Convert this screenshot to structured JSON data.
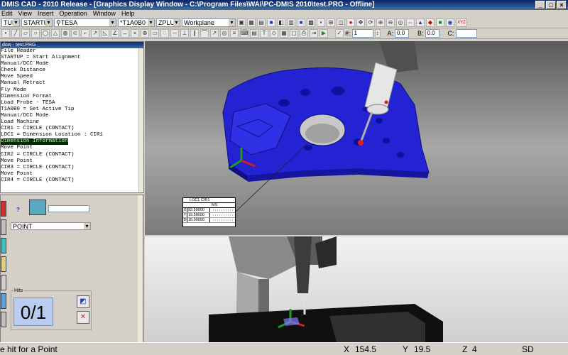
{
  "window": {
    "title": "DMIS CAD - 2010 Release - [Graphics Display Window - C:\\Program Files\\WAI\\PC-DMIS 2010\\test.PRG - Offline]"
  },
  "menu": [
    "Edit",
    "View",
    "Insert",
    "Operation",
    "Window",
    "Help"
  ],
  "toolbar": {
    "combo_alignment1": "TUP",
    "combo_alignment2": "STARTUP",
    "combo_probe": "TESA",
    "combo_tip": "T1A0B0",
    "combo_plane": "ZPLUS",
    "combo_workplane": "Workplane",
    "xyz_label": "XYZ",
    "field1_value": "1",
    "label_a": "A:",
    "field_a_value": "0.0",
    "label_b": "B:",
    "field_b_value": "0.0",
    "label_c": "C:",
    "field_c_value": ""
  },
  "edit_window": {
    "title": "dow - test.PRG",
    "lines": [
      "File Header",
      "STARTUP = Start Alignment",
      "Manual/DCC Mode",
      "Check Distance",
      "Move Speed",
      "Manual Retract",
      "Fly Mode",
      "Dimension Format",
      "Load Probe - TESA",
      "T1A0B0 = Set Active Tip",
      "Manual/DCC Mode",
      "Load Machine",
      "CIR1 = CIRCLE (CONTACT)",
      "LOC1 = Dimension Location : CIR1",
      "Dimension Information",
      "Move Point",
      "CIR2 = CIRCLE (CONTACT)",
      "Move Point",
      "CIR3 = CIRCLE (CONTACT)",
      "Move Point",
      "CIR4 = CIRCLE (CONTACT)"
    ],
    "selected_index": 14
  },
  "dialog": {
    "help_symbol": "?",
    "feature_type": "POINT",
    "hits_label": "Hits",
    "hits_count": "0/1"
  },
  "dimension_label": {
    "header": "LOC1 CIR1",
    "ms": "MS",
    "rows": [
      {
        "axis": "X",
        "value": "93.50000"
      },
      {
        "axis": "Y",
        "value": "19.50000"
      },
      {
        "axis": "D",
        "value": "15.00000"
      }
    ]
  },
  "status": {
    "prompt": "e hit for a Point",
    "x_label": "X",
    "x_value": "154.5",
    "y_label": "Y",
    "y_value": "19.5",
    "z_label": "Z",
    "z_value": "4",
    "mode": "SD"
  },
  "colors": {
    "part": "#2a2ad8",
    "highlight": "#002a00"
  }
}
